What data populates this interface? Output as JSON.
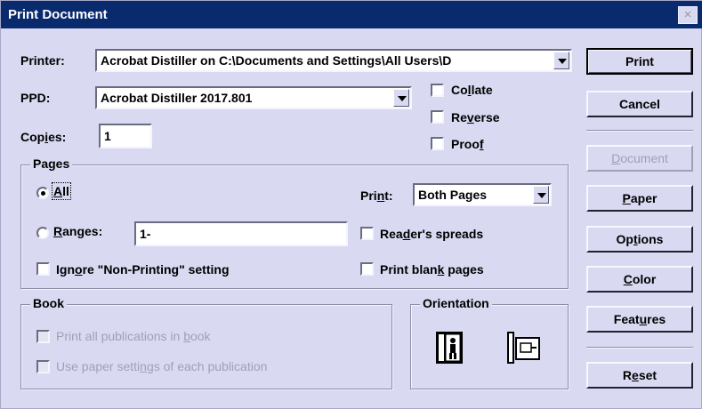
{
  "window": {
    "title": "Print Document",
    "close_glyph": "×"
  },
  "printer": {
    "label": "Printer:",
    "value": "Acrobat Distiller on C:\\Documents and Settings\\All Users\\D"
  },
  "ppd": {
    "label": "PPD:",
    "value": "Acrobat Distiller 2017.801"
  },
  "copies": {
    "label": "Copies:",
    "value": "1"
  },
  "options": {
    "collate": "Collate",
    "reverse": "Reverse",
    "proof": "Proof"
  },
  "pages": {
    "legend": "Pages",
    "all": "All",
    "ranges": "Ranges:",
    "ranges_value": "1-",
    "ignore": "Ignore \"Non-Printing\" setting",
    "print_label": "Print:",
    "print_value": "Both Pages",
    "readers_spreads": "Reader's spreads",
    "print_blank": "Print blank pages"
  },
  "book": {
    "legend": "Book",
    "print_all": "Print all publications in book",
    "use_paper": "Use paper settings of each publication"
  },
  "orientation": {
    "legend": "Orientation"
  },
  "buttons": {
    "print": "Print",
    "cancel": "Cancel",
    "document": "Document",
    "paper": "Paper",
    "options": "Options",
    "color": "Color",
    "features": "Features",
    "reset": "Reset"
  },
  "colors": {
    "dialog_bg": "#d9d9f2",
    "titlebar": "#0a2a6e",
    "disabled_text": "#a0a0b4"
  }
}
